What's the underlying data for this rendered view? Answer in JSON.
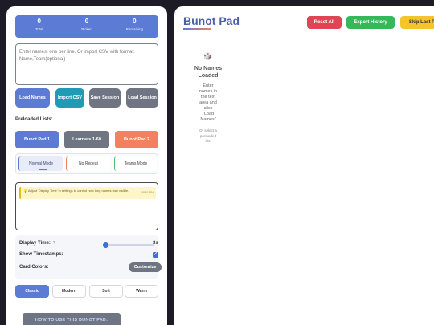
{
  "stats": [
    {
      "value": "0",
      "label": "Total"
    },
    {
      "value": "0",
      "label": "Picked"
    },
    {
      "value": "0",
      "label": "Remaining"
    }
  ],
  "names_input": {
    "placeholder": "Enter names, one per line. Or import CSV with format: Name,Team(optional)",
    "value": ""
  },
  "actions": {
    "load": "Load Names",
    "import": "Import CSV",
    "save": "Save Session",
    "load_session": "Load Session"
  },
  "preloaded": {
    "title": "Preloaded Lists:",
    "items": [
      "Bunot Pad 1",
      "Learners 1-60",
      "Bunot Pad 2"
    ]
  },
  "modes": {
    "items": [
      "Normal Mode",
      "No Repeat",
      "Teams Mode"
    ],
    "selected": "Normal Mode"
  },
  "history": {
    "hint": "💡 Adjust 'Display Time' in settings to control how long names stay visible.",
    "hint_time": "08:51 PM"
  },
  "settings": {
    "display_time_label": "Display Time:",
    "display_time_help": "?",
    "display_time_value": "3s",
    "display_time_fraction": 0.05,
    "timestamps_label": "Show Timestamps:",
    "timestamps_checked": true,
    "card_colors_label": "Card Colors:",
    "customize": "Customize"
  },
  "themes": {
    "items": [
      "Classic",
      "Modern",
      "Soft",
      "Warm"
    ],
    "selected": "Classic"
  },
  "howto": "HOW TO USE THIS BUNOT PAD:",
  "header": {
    "title": "Bunot Pad",
    "reset": "Reset All",
    "export": "Export History",
    "skip": "Skip Last P"
  },
  "empty_state": {
    "icon": "dice-icon",
    "title": "No Names Loaded",
    "desc": "Enter names in the text area and click \"Load Names\"",
    "sub": "Or select a preloaded list."
  },
  "colors": {
    "primary": "#5b7bd5",
    "import": "#1f9bb6",
    "gray": "#6f7582",
    "orange": "#f2825f",
    "reset": "#e04555",
    "export": "#34b85a",
    "skip": "#f4c52a",
    "title": "#4a5fa8"
  }
}
